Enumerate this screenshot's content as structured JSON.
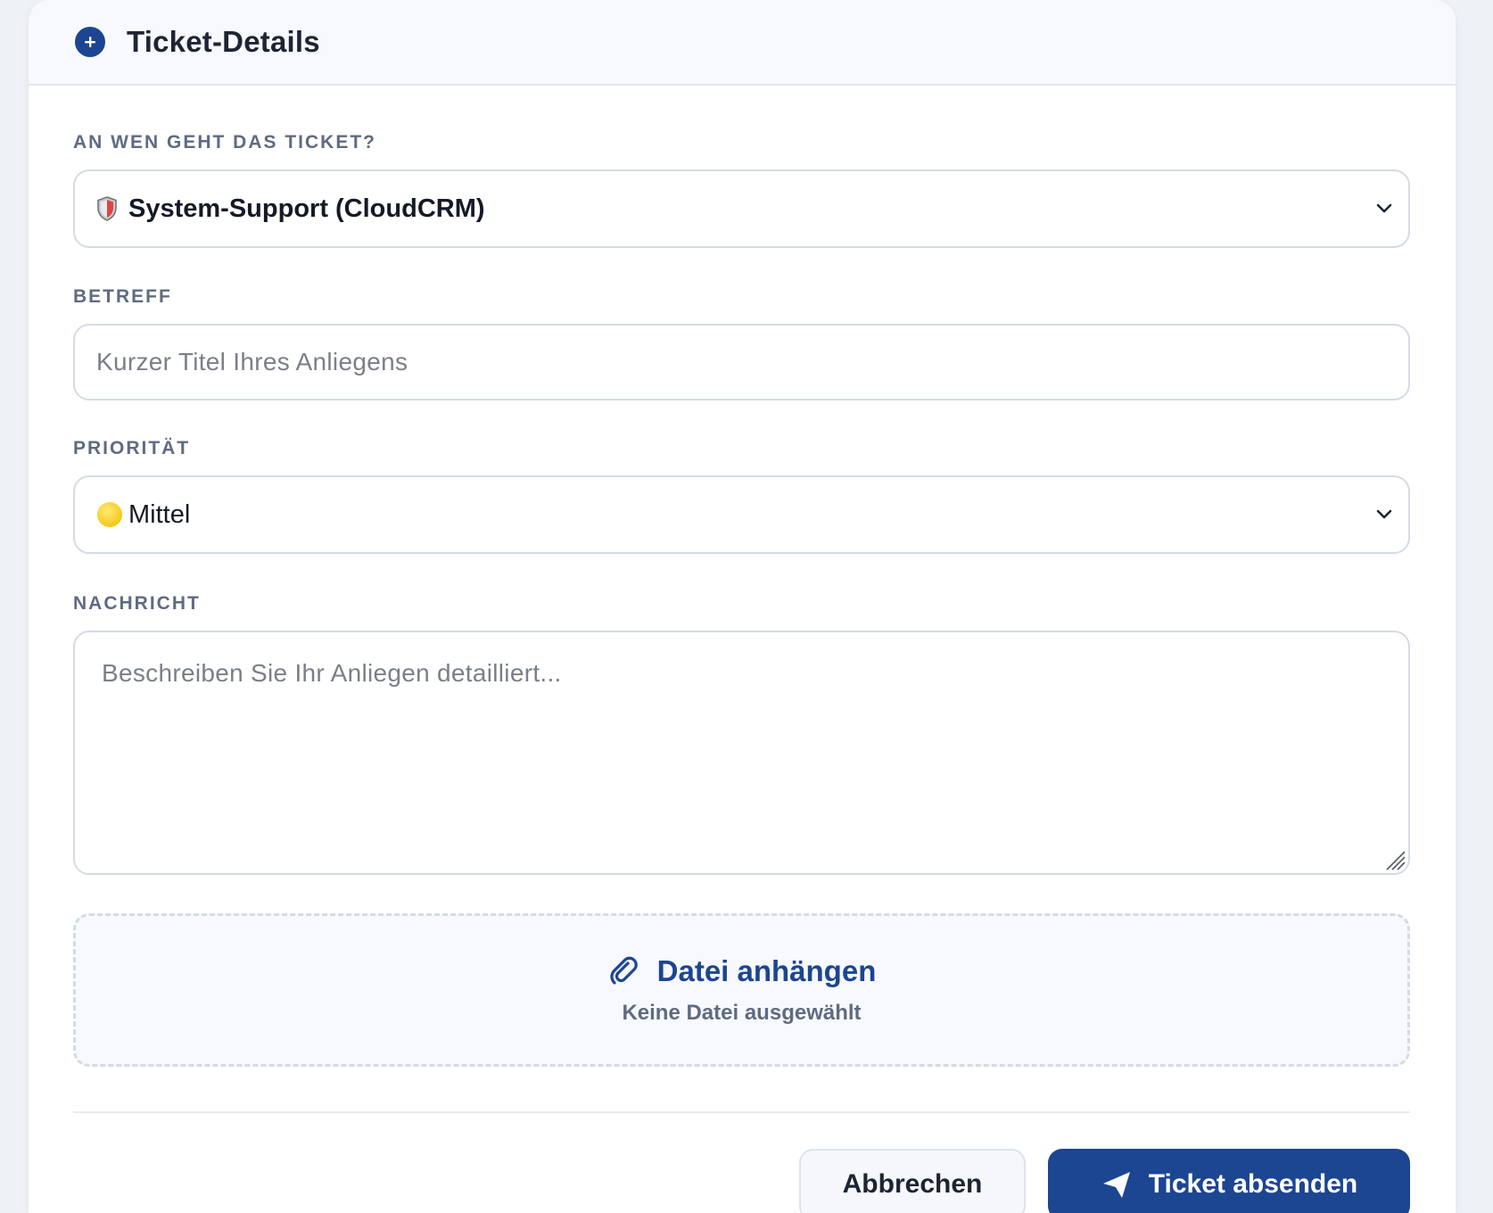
{
  "header": {
    "title": "Ticket-Details",
    "icon": "plus-circle-icon"
  },
  "recipient": {
    "label": "AN WEN GEHT DAS TICKET?",
    "selected": "System-Support (CloudCRM)",
    "icon": "shield-icon"
  },
  "subject": {
    "label": "BETREFF",
    "placeholder": "Kurzer Titel Ihres Anliegens",
    "value": ""
  },
  "priority": {
    "label": "PRIORITÄT",
    "selected": "Mittel",
    "icon": "yellow-circle-icon"
  },
  "message": {
    "label": "NACHRICHT",
    "placeholder": "Beschreiben Sie Ihr Anliegen detailliert...",
    "value": ""
  },
  "attachment": {
    "action": "Datei anhängen",
    "status": "Keine Datei ausgewählt",
    "icon": "paperclip-icon"
  },
  "buttons": {
    "cancel": "Abbrechen",
    "submit": "Ticket absenden",
    "submit_icon": "send-icon"
  },
  "colors": {
    "primary": "#1c4592",
    "label": "#5f6b80",
    "border": "#d4dbe5",
    "header_bg": "#f7f9fc",
    "page_bg": "#eef1f6"
  }
}
